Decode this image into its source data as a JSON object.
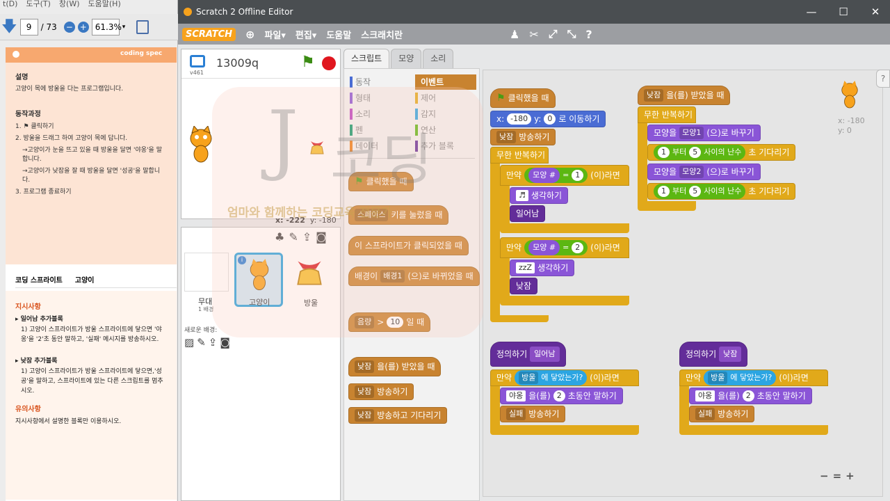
{
  "pdf": {
    "menu": [
      "t(D)",
      "도구(T)",
      "창(W)",
      "도움말(H)"
    ],
    "page_current": "9",
    "page_total": "/ 73",
    "zoom": "61.3%",
    "brand": "coding spec",
    "desc_title": "설명",
    "desc_text": "고양이 목에 방울을 다는 프로그램입니다.",
    "process_title": "동작과정",
    "steps": [
      "1.  ⚑  클릭하기",
      "2. 방울을 드래그 하여 고양이 목에 답니다.",
      "→고양이가 눈을 뜨고 있을 때 방울을 달면 '야옹'을 말합니다.",
      "→고양이가 낮잠을 잘 때 방울을 달면 '성공'을 말합니다.",
      "3. 프로그램 종료하기"
    ],
    "tab1": "코딩 스프라이트",
    "tab2": "고양이",
    "instr_title": "지시사항",
    "item1_title": "▸ 일어남 추가블록",
    "item1_text": "1) 고양이 스프라이트가 방울 스프라이트에 닿으면 '야옹'을 '2'초 동안 말하고, '실패' 메시지를 방송하시오.",
    "item2_title": "▸ 낮잠 추가블록",
    "item2_text": "1) 고양이 스프라이트가 방울 스프라이트에 닿으면,'성공'을 말하고, 스프라이트에 있는 다른 스크립트를 멈추시오.",
    "note_title": "유의사항",
    "note_text": "지시사항에서 설명한 블록만 이용하시오."
  },
  "window": {
    "title": "Scratch 2 Offline Editor",
    "min": "—",
    "max": "☐",
    "close": "✕"
  },
  "menubar": {
    "logo": "SCRATCH",
    "globe": "⊕",
    "file": "파일▾",
    "edit": "편집▾",
    "help": "도움말",
    "tips": "스크래치란"
  },
  "stage": {
    "project_name": "13009q",
    "version": "v461",
    "coords_x": "x: -222",
    "coords_y": "y: -180"
  },
  "sprites": {
    "stage_label": "무대",
    "stage_sub": "1 배경",
    "new_backdrop": "새로운 배경:",
    "cat_label": "고양이",
    "bell_label": "방울"
  },
  "tabs": [
    "스크립트",
    "모양",
    "소리"
  ],
  "categories": [
    {
      "label": "동작",
      "color": "#4a6cd4"
    },
    {
      "label": "이벤트",
      "color": "#c88330"
    },
    {
      "label": "형태",
      "color": "#8a55d7"
    },
    {
      "label": "제어",
      "color": "#e1a91a"
    },
    {
      "label": "소리",
      "color": "#bb42c3"
    },
    {
      "label": "감지",
      "color": "#2ca5e2"
    },
    {
      "label": "펜",
      "color": "#0e9a6c"
    },
    {
      "label": "연산",
      "color": "#5cb712"
    },
    {
      "label": "데이터",
      "color": "#ee7d16"
    },
    {
      "label": "추가 블록",
      "color": "#632d99"
    }
  ],
  "palette_blocks": {
    "flag_clicked": "클릭했을 때",
    "key_pressed_pre": "스페이스",
    "key_pressed_post": "키를 눌렀을 때",
    "sprite_clicked": "이 스프라이트가 클릭되었을 때",
    "backdrop_pre": "배경이",
    "backdrop_val": "배경1",
    "backdrop_post": "(으)로 바뀌었을 때",
    "loudness_pre": "음량",
    "loudness_val": "10",
    "loudness_post": "일 때",
    "receive_val": "낮잠",
    "receive_post": "을(를) 받았을 때",
    "broadcast_val": "낮잠",
    "broadcast_post": "방송하기",
    "broadcast_wait_val": "낮잠",
    "broadcast_wait_post": "방송하고 기다리기"
  },
  "script1": {
    "hat": "클릭했을 때",
    "goto_x": "x:",
    "goto_xv": "-180",
    "goto_y": "y:",
    "goto_yv": "0",
    "goto_post": "로 이동하기",
    "bc_val": "낮잠",
    "bc_post": "방송하기",
    "forever": "무한 반복하기",
    "if1": "만약",
    "cost1": "모양 #",
    "eq": "=",
    "v1": "1",
    "then": "(이)라면",
    "think1_val": "♬",
    "think1_post": "생각하기",
    "call1": "일어남",
    "if2": "만약",
    "cost2": "모양 #",
    "v2": "2",
    "think2_val": "zzZ",
    "think2_post": "생각하기",
    "call2": "낮잠"
  },
  "script2": {
    "hat_val": "낮잠",
    "hat_post": "을(를) 받았을 때",
    "forever": "무한 반복하기",
    "sw1_pre": "모양을",
    "sw1_val": "모양1",
    "sw1_post": "(으)로 바꾸기",
    "r1_from": "1",
    "r1_mid": "부터",
    "r1_to": "5",
    "r1_post": "사이의 난수",
    "wait_post": "초 기다리기",
    "sw2_pre": "모양을",
    "sw2_val": "모양2",
    "sw2_post": "(으)로 바꾸기",
    "r2_from": "1",
    "r2_to": "5"
  },
  "script3": {
    "define": "정의하기",
    "name": "일어남",
    "if": "만약",
    "touch_val": "방울",
    "touch_post": "에 닿았는가?",
    "then": "(이)라면",
    "say_val": "야옹",
    "say_mid": "을(를)",
    "say_secs": "2",
    "say_post": "초동안 말하기",
    "bc_val": "실패",
    "bc_post": "방송하기"
  },
  "script4": {
    "define": "정의하기",
    "name": "낮잠",
    "if": "만약",
    "touch_val": "방울",
    "touch_post": "에 닿았는가?",
    "then": "(이)라면",
    "say_val": "야옹",
    "say_mid": "을(를)",
    "say_secs": "2",
    "say_post": "초동안 말하기",
    "bc_val": "실패",
    "bc_post": "방송하기"
  },
  "script_area": {
    "coord_x": "x: -180",
    "coord_y": "y: 0",
    "zoom_out": "−",
    "zoom_reset": "=",
    "zoom_in": "+"
  },
  "watermark": {
    "big1": "J",
    "big2": "코딩",
    "slogan": "엄마와 함께하는 코딩교육 전문가"
  },
  "help_icon": "?"
}
